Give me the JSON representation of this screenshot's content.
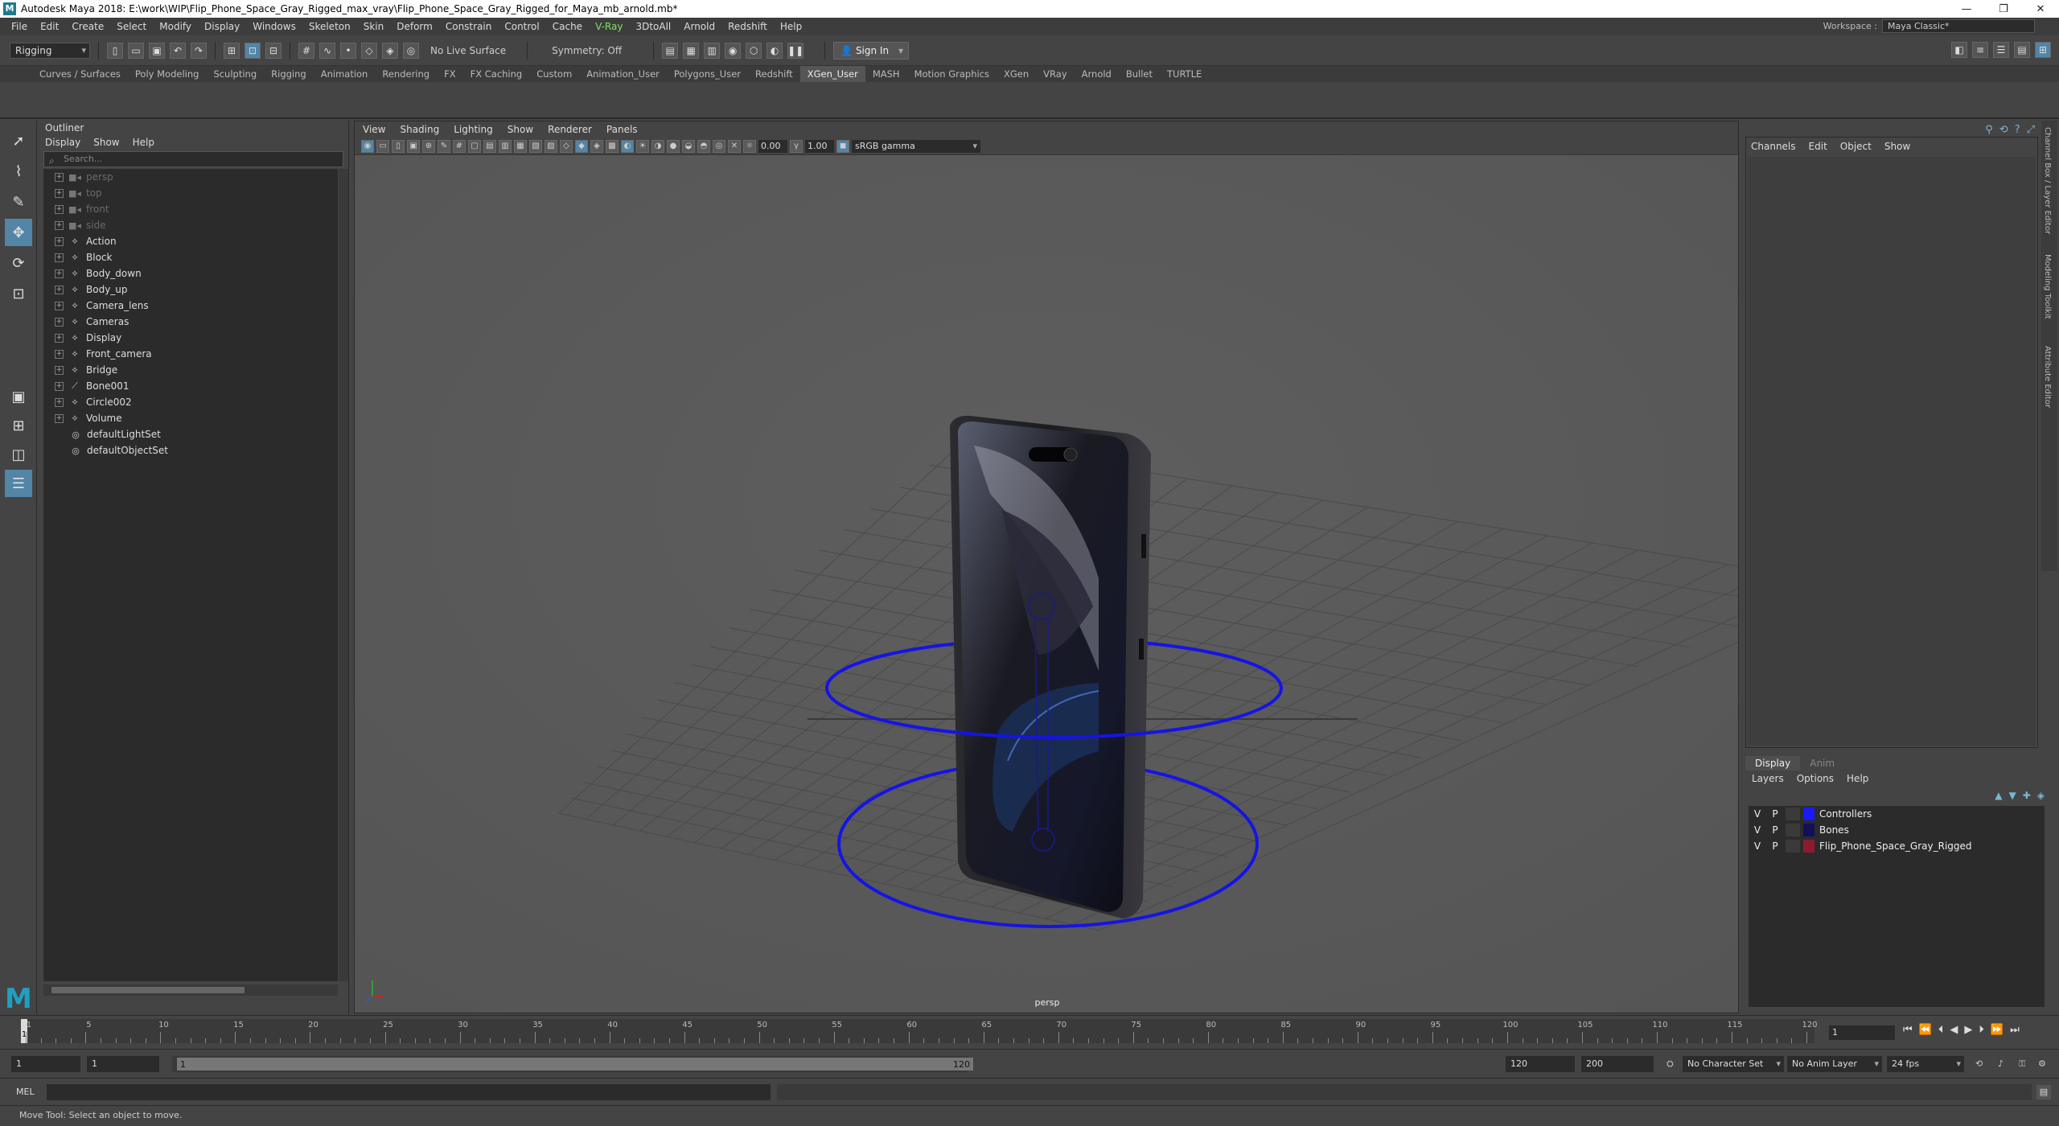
{
  "window": {
    "title": "Autodesk Maya 2018: E:\\work\\WIP\\Flip_Phone_Space_Gray_Rigged_max_vray\\Flip_Phone_Space_Gray_Rigged_for_Maya_mb_arnold.mb*",
    "minimize": "—",
    "restore": "❐",
    "close": "✕"
  },
  "menubar": {
    "items": [
      "File",
      "Edit",
      "Create",
      "Select",
      "Modify",
      "Display",
      "Windows",
      "Skeleton",
      "Skin",
      "Deform",
      "Constrain",
      "Control",
      "Cache",
      "V-Ray",
      "3DtoAll",
      "Arnold",
      "Redshift",
      "Help"
    ],
    "workspace_label": "Workspace :",
    "workspace_value": "Maya Classic*"
  },
  "statusline": {
    "menuset": "Rigging",
    "live_surface": "No Live Surface",
    "symmetry": "Symmetry: Off",
    "sign_in": "Sign In"
  },
  "shelf": {
    "tabs": [
      "Curves / Surfaces",
      "Poly Modeling",
      "Sculpting",
      "Rigging",
      "Animation",
      "Rendering",
      "FX",
      "FX Caching",
      "Custom",
      "Animation_User",
      "Polygons_User",
      "Redshift",
      "XGen_User",
      "MASH",
      "Motion Graphics",
      "XGen",
      "VRay",
      "Arnold",
      "Bullet",
      "TURTLE"
    ],
    "active_tab": "XGen_User"
  },
  "outliner": {
    "title": "Outliner",
    "menu": [
      "Display",
      "Show",
      "Help"
    ],
    "search_placeholder": "Search...",
    "items": [
      {
        "label": "persp",
        "type": "camera",
        "dim": true
      },
      {
        "label": "top",
        "type": "camera",
        "dim": true
      },
      {
        "label": "front",
        "type": "camera",
        "dim": true
      },
      {
        "label": "side",
        "type": "camera",
        "dim": true
      },
      {
        "label": "Action",
        "type": "group",
        "dim": false
      },
      {
        "label": "Block",
        "type": "group",
        "dim": false
      },
      {
        "label": "Body_down",
        "type": "group",
        "dim": false
      },
      {
        "label": "Body_up",
        "type": "group",
        "dim": false
      },
      {
        "label": "Camera_lens",
        "type": "group",
        "dim": false
      },
      {
        "label": "Cameras",
        "type": "group",
        "dim": false
      },
      {
        "label": "Display",
        "type": "group",
        "dim": false
      },
      {
        "label": "Front_camera",
        "type": "group",
        "dim": false
      },
      {
        "label": "Bridge",
        "type": "group",
        "dim": false
      },
      {
        "label": "Bone001",
        "type": "joint",
        "dim": false
      },
      {
        "label": "Circle002",
        "type": "group",
        "dim": false
      },
      {
        "label": "Volume",
        "type": "group",
        "dim": false
      }
    ],
    "sets": [
      "defaultLightSet",
      "defaultObjectSet"
    ]
  },
  "viewport": {
    "menu": [
      "View",
      "Shading",
      "Lighting",
      "Show",
      "Renderer",
      "Panels"
    ],
    "exposure": "0.00",
    "gamma": "1.00",
    "color_space": "sRGB gamma",
    "camera_label": "persp"
  },
  "channel_box": {
    "menu": [
      "Channels",
      "Edit",
      "Object",
      "Show"
    ],
    "side_tabs": [
      "Channel Box / Layer Editor",
      "Modeling Toolkit",
      "Attribute Editor"
    ]
  },
  "layer_editor": {
    "tabs": [
      "Display",
      "Anim"
    ],
    "active_tab": "Display",
    "menu": [
      "Layers",
      "Options",
      "Help"
    ],
    "layers": [
      {
        "v": "V",
        "p": "P",
        "name": "Controllers",
        "color": "#1a1aff"
      },
      {
        "v": "V",
        "p": "P",
        "name": "Bones",
        "color": "#10105a"
      },
      {
        "v": "V",
        "p": "P",
        "name": "Flip_Phone_Space_Gray_Rigged",
        "color": "#8c1a2e"
      }
    ]
  },
  "timeline": {
    "ticks": [
      "1",
      "5",
      "10",
      "15",
      "20",
      "25",
      "30",
      "35",
      "40",
      "45",
      "50",
      "55",
      "60",
      "65",
      "70",
      "75",
      "80",
      "85",
      "90",
      "95",
      "100",
      "105",
      "110",
      "115",
      "120"
    ],
    "current_frame": "1",
    "current_field": "1"
  },
  "range": {
    "start": "1",
    "playback_start": "1",
    "range_start_label": "1",
    "range_end_label": "120",
    "playback_end": "120",
    "end": "200",
    "character_set": "No Character Set",
    "anim_layer": "No Anim Layer",
    "fps": "24 fps"
  },
  "command": {
    "language": "MEL"
  },
  "helpline": {
    "text": "Move Tool: Select an object to move."
  },
  "colors": {
    "controller_blue": "#1414e6",
    "accent": "#5285a6"
  }
}
